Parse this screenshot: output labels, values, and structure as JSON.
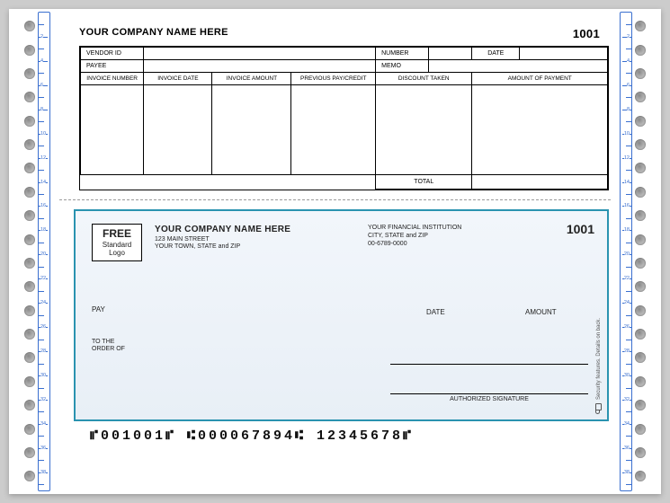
{
  "voucher": {
    "company_line": "YOUR COMPANY NAME HERE",
    "number": "1001",
    "labels": {
      "vendor_id": "VENDOR ID",
      "number": "NUMBER",
      "date": "DATE",
      "payee": "PAYEE",
      "memo": "MEMO"
    },
    "columns": [
      "INVOICE NUMBER",
      "INVOICE DATE",
      "INVOICE AMOUNT",
      "PREVIOUS PAY/CREDIT",
      "DISCOUNT TAKEN",
      "AMOUNT OF PAYMENT"
    ],
    "total_label": "TOTAL"
  },
  "check": {
    "logo": {
      "free": "FREE",
      "line2": "Standard",
      "line3": "Logo"
    },
    "company": {
      "name": "YOUR COMPANY NAME HERE",
      "addr1": "123 MAIN STREET",
      "addr2": "YOUR TOWN, STATE and ZIP"
    },
    "bank": {
      "name": "YOUR FINANCIAL INSTITUTION",
      "addr": "CITY, STATE and ZIP",
      "routing_display": "00-6789-0000"
    },
    "number": "1001",
    "labels": {
      "pay": "PAY",
      "date": "DATE",
      "amount": "AMOUNT",
      "order1": "TO THE",
      "order2": "ORDER OF",
      "signature": "AUTHORIZED SIGNATURE"
    },
    "security_text": "Security features. Details on back.",
    "micr": "⑈001001⑈  ⑆000067894⑆  12345678⑈"
  },
  "ruler": {
    "count": 39
  }
}
